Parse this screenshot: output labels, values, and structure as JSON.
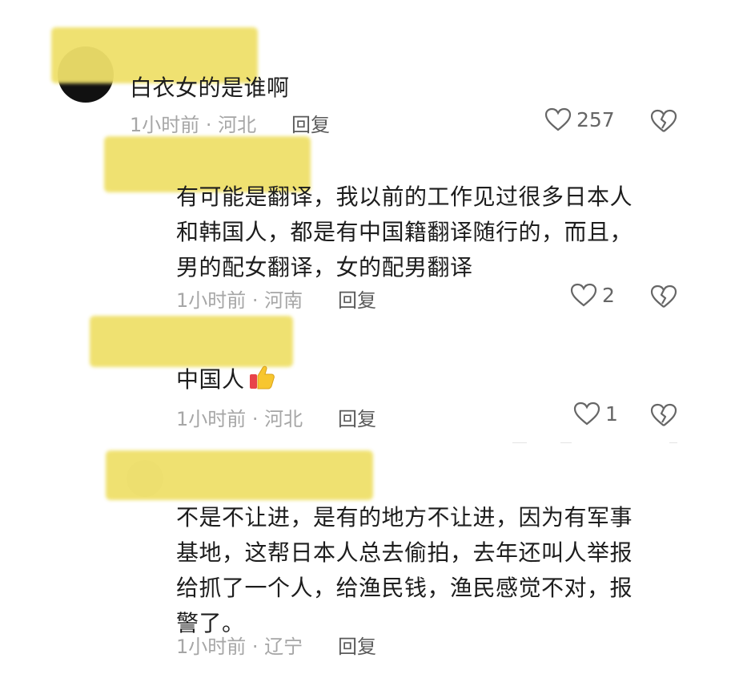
{
  "comments": [
    {
      "text": "白衣女的是谁啊",
      "meta": "1小时前 · 河北",
      "reply_label": "回复",
      "likes": "257"
    },
    {
      "text": "有可能是翻译，我以前的工作见过很多日本人\n和韩国人，都是有中国籍翻译随行的，而且，\n男的配女翻译，女的配男翻译",
      "meta": "1小时前 · 河南",
      "reply_label": "回复",
      "likes": "2"
    },
    {
      "text": "中国人",
      "emoji": "thumbs-up",
      "meta": "1小时前 · 河北",
      "reply_label": "回复",
      "likes": "1"
    },
    {
      "text": "不是不让进，是有的地方不让进，因为有军事\n基地，这帮日本人总去偷拍，去年还叫人举报\n给抓了一个人，给渔民钱，渔民感觉不对，报\n警了。",
      "meta": "1小时前 · 辽宁",
      "reply_label": "回复"
    }
  ],
  "colors": {
    "redaction": "#efe06a",
    "meta_text": "#a6a6a6",
    "body_text": "#1d1d1d"
  },
  "icons": {
    "like": "heart-outline-icon",
    "dislike": "broken-heart-icon"
  }
}
